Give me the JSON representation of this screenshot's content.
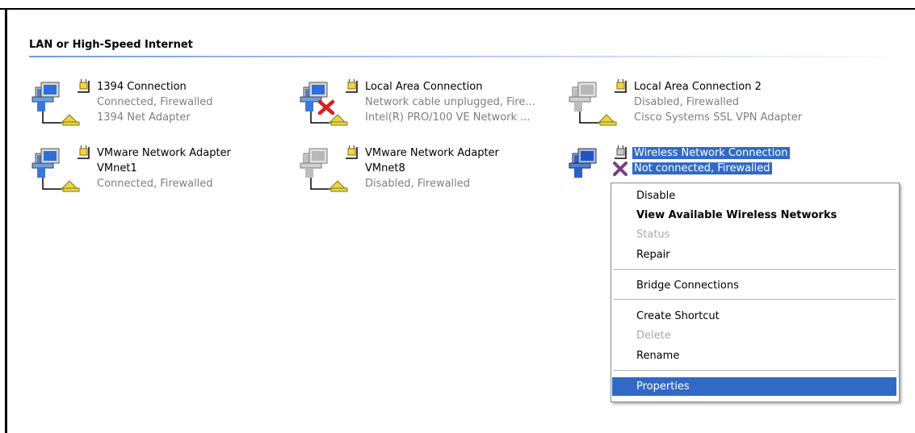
{
  "section": {
    "title": "LAN or High-Speed Internet"
  },
  "connections": [
    {
      "name": "1394 Connection",
      "status": "Connected, Firewalled",
      "device": "1394 Net Adapter",
      "state": "connected"
    },
    {
      "name": "Local Area Connection",
      "status": "Network cable unplugged, Fire...",
      "device": "Intel(R) PRO/100 VE Network ...",
      "state": "unplugged"
    },
    {
      "name": "Local Area Connection 2",
      "status": "Disabled, Firewalled",
      "device": "Cisco Systems SSL VPN Adapter",
      "state": "disabled"
    },
    {
      "name": "VMware Network Adapter",
      "name2": "VMnet1",
      "status": "Connected, Firewalled",
      "state": "connected"
    },
    {
      "name": "VMware Network Adapter",
      "name2": "VMnet8",
      "status": "Disabled, Firewalled",
      "state": "disabled"
    },
    {
      "name": "Wireless Network Connection",
      "status": "Not connected, Firewalled",
      "state": "wireless-not-connected",
      "selected": true
    }
  ],
  "context_menu": {
    "items": [
      {
        "label": "Disable",
        "style": "normal"
      },
      {
        "label": "View Available Wireless Networks",
        "style": "bold"
      },
      {
        "label": "Status",
        "style": "disabled"
      },
      {
        "label": "Repair",
        "style": "normal"
      },
      {
        "label": "Bridge Connections",
        "style": "normal"
      },
      {
        "label": "Create Shortcut",
        "style": "normal"
      },
      {
        "label": "Delete",
        "style": "disabled"
      },
      {
        "label": "Rename",
        "style": "normal"
      },
      {
        "label": "Properties",
        "style": "highlighted"
      }
    ]
  },
  "colors": {
    "selection": "#316ac5",
    "disabled_text": "#a8a8a8",
    "status_text": "#7f7f7f"
  },
  "icons": [
    "network-connection-icon",
    "padlock-icon",
    "red-x-icon",
    "purple-x-icon"
  ]
}
